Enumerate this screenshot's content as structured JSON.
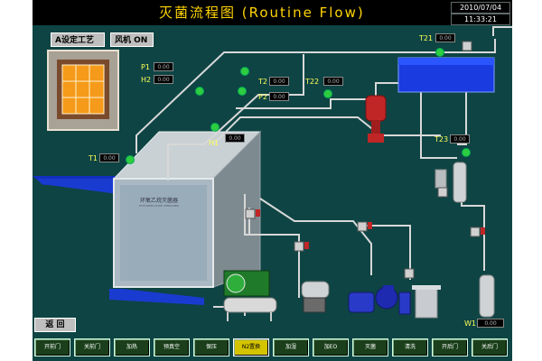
{
  "title": "灭菌流程图 (Routine Flow)",
  "date": "2010/07/04",
  "time": "11:33:21",
  "indicators": {
    "process": "A设定工艺",
    "fan": "风机 ON"
  },
  "sensors": [
    {
      "id": "P1",
      "label": "P1",
      "value": "0.00"
    },
    {
      "id": "H2",
      "label": "H2",
      "value": "0.00"
    },
    {
      "id": "T2",
      "label": "T2",
      "value": "0.00"
    },
    {
      "id": "P2",
      "label": "P2",
      "value": "0.00"
    },
    {
      "id": "T22",
      "label": "T22",
      "value": "0.00"
    },
    {
      "id": "H1",
      "label": "H1",
      "value": "0.00"
    },
    {
      "id": "T1",
      "label": "T1",
      "value": "0.00"
    },
    {
      "id": "T21",
      "label": "T21",
      "value": "0.00"
    },
    {
      "id": "T23",
      "label": "T23",
      "value": "0.00"
    },
    {
      "id": "W1",
      "label": "W1",
      "value": "0.00"
    }
  ],
  "sterilizer_label": "环氧乙烷灭菌器",
  "sterilizer_sublabel": "ETHYLENE OXIDE STERILIZER",
  "back_label": "返 回",
  "buttons": [
    {
      "label": "开前门",
      "active": false
    },
    {
      "label": "关前门",
      "active": false
    },
    {
      "label": "加热",
      "active": false
    },
    {
      "label": "预真空",
      "active": false
    },
    {
      "label": "保压",
      "active": false
    },
    {
      "label": "N2置换",
      "active": true
    },
    {
      "label": "加湿",
      "active": false
    },
    {
      "label": "加EO",
      "active": false
    },
    {
      "label": "灭菌",
      "active": false
    },
    {
      "label": "清洗",
      "active": false
    },
    {
      "label": "开后门",
      "active": false
    },
    {
      "label": "关后门",
      "active": false
    }
  ],
  "colors": {
    "background": "#0e4444",
    "pipe": "#d8d8d8",
    "active_button": "#d4c400",
    "title": "#ffd400"
  }
}
